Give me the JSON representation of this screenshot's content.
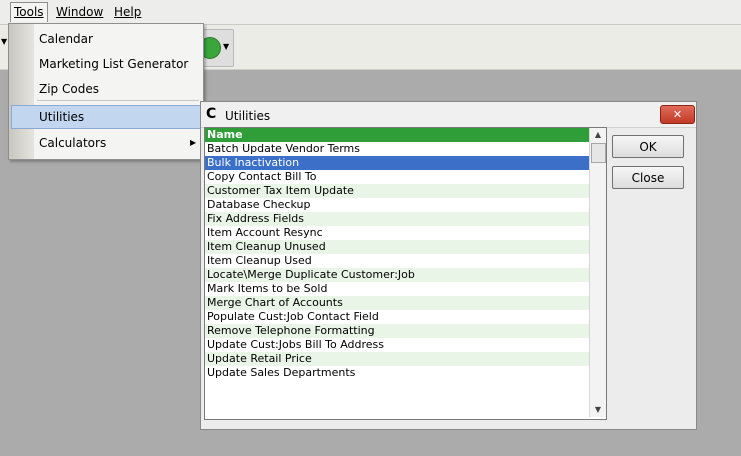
{
  "menubar": {
    "tools": "Tools",
    "window": "Window",
    "help": "Help"
  },
  "tools_menu": {
    "items": [
      "Calendar",
      "Marketing List Generator",
      "Zip Codes",
      "Utilities",
      "Calculators"
    ],
    "highlighted": "Utilities"
  },
  "dialog": {
    "title": "Utilities",
    "list_header": "Name",
    "rows": [
      "Batch Update Vendor Terms",
      "Bulk Inactivation",
      "Copy Contact Bill To",
      "Customer Tax Item Update",
      "Database Checkup",
      "Fix Address Fields",
      "Item Account Resync",
      "Item Cleanup Unused",
      "Item Cleanup Used",
      "Locate\\Merge Duplicate Customer:Job",
      "Mark Items to be Sold",
      "Merge Chart of Accounts",
      "Populate Cust:Job Contact Field",
      "Remove Telephone Formatting",
      "Update Cust:Jobs Bill To Address",
      "Update Retail Price",
      "Update Sales Departments"
    ],
    "selected_row": "Bulk Inactivation",
    "ok_label": "OK",
    "close_label": "Close"
  },
  "colors": {
    "list_header": "#2f9e38",
    "selection": "#3b6fc8",
    "menu_highlight": "#c2d7ef"
  },
  "icons": {
    "dialog_icon": "app-logo-icon",
    "close": "close-icon",
    "scroll_up": "scroll-up-icon",
    "scroll_down": "scroll-down-icon",
    "submenu": "submenu-arrow-icon"
  }
}
